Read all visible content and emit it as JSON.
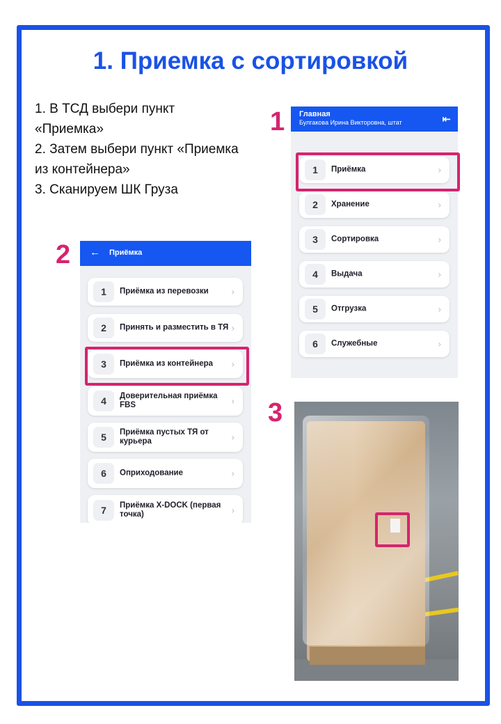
{
  "title": "1. Приемка с сортировкой",
  "instructions": [
    "1. В ТСД выбери пункт",
    "«Приемка»",
    "2. Затем выбери пункт «Приемка",
    "из контейнера»",
    "3. Сканируем ШК Груза"
  ],
  "markers": {
    "one": "1",
    "two": "2",
    "three": "3"
  },
  "screen1": {
    "header_title": "Главная",
    "header_user": "Булгакова Ирина Викторовна, штат",
    "logout_icon": "logout-icon",
    "items": [
      {
        "num": "1",
        "label": "Приёмка"
      },
      {
        "num": "2",
        "label": "Хранение"
      },
      {
        "num": "3",
        "label": "Сортировка"
      },
      {
        "num": "4",
        "label": "Выдача"
      },
      {
        "num": "5",
        "label": "Отгрузка"
      },
      {
        "num": "6",
        "label": "Служебные"
      }
    ]
  },
  "screen2": {
    "header_title": "Приёмка",
    "back_icon": "back-arrow-icon",
    "items": [
      {
        "num": "1",
        "label": "Приёмка из перевозки"
      },
      {
        "num": "2",
        "label": "Принять и разместить в ТЯ"
      },
      {
        "num": "3",
        "label": "Приёмка из контейнера"
      },
      {
        "num": "4",
        "label": "Доверительная приёмка FBS"
      },
      {
        "num": "5",
        "label": "Приёмка пустых ТЯ от курьера"
      },
      {
        "num": "6",
        "label": "Оприходование"
      },
      {
        "num": "7",
        "label": "Приёмка X-DOCK (первая точка)"
      }
    ]
  },
  "colors": {
    "accent": "#1a52e6",
    "highlight": "#d6246e",
    "header": "#1557f0"
  }
}
